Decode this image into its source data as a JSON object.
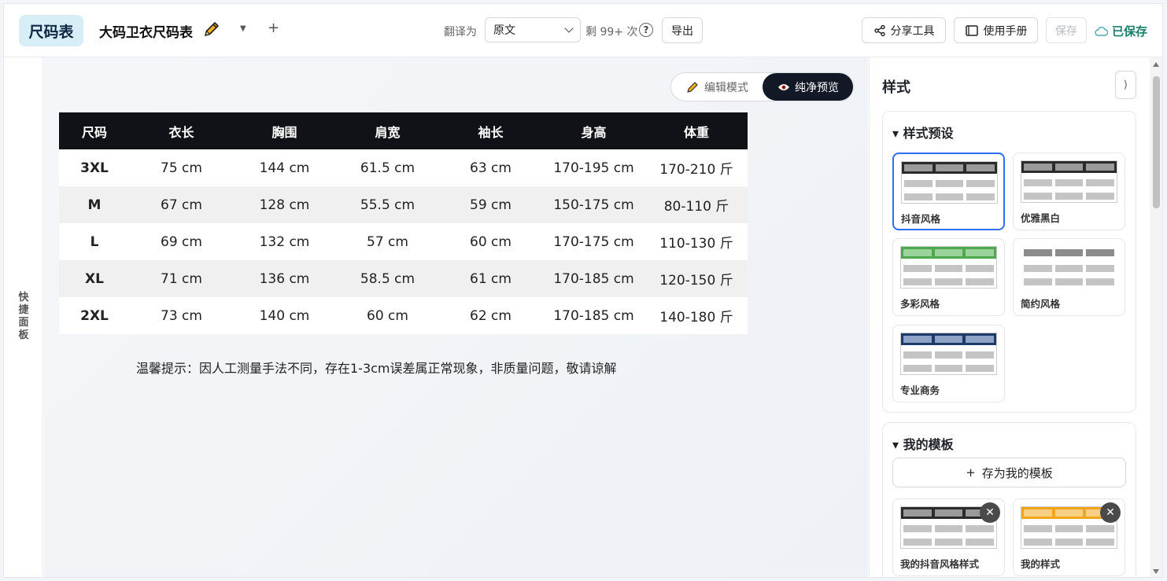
{
  "header": {
    "logo": "尺码表",
    "doc_title": "大码卫衣尺码表",
    "translate_label": "翻译为",
    "translate_value": "原文",
    "remaining": "剩 99+ 次",
    "help": "?",
    "export": "导出",
    "share": "分享工具",
    "manual": "使用手册",
    "save": "保存",
    "saved_status": "已保存"
  },
  "quick_panel": {
    "label": "快捷面板"
  },
  "mode": {
    "edit": "编辑模式",
    "preview": "纯净预览",
    "active": "preview"
  },
  "table": {
    "headers": [
      "尺码",
      "衣长",
      "胸围",
      "肩宽",
      "袖长",
      "身高",
      "体重"
    ],
    "rows": [
      [
        "3XL",
        "75 cm",
        "144 cm",
        "61.5 cm",
        "63 cm",
        "170-195 cm",
        "170-210 斤"
      ],
      [
        "M",
        "67 cm",
        "128 cm",
        "55.5 cm",
        "59 cm",
        "150-175 cm",
        "80-110 斤"
      ],
      [
        "L",
        "69 cm",
        "132 cm",
        "57 cm",
        "60 cm",
        "170-175 cm",
        "110-130 斤"
      ],
      [
        "XL",
        "71 cm",
        "136 cm",
        "58.5 cm",
        "61 cm",
        "170-185 cm",
        "120-150 斤"
      ],
      [
        "2XL",
        "73 cm",
        "140 cm",
        "60 cm",
        "62 cm",
        "170-185 cm",
        "140-180 斤"
      ]
    ]
  },
  "tip": "温馨提示：因人工测量手法不同，存在1-3cm误差属正常现象，非质量问题，敬请谅解",
  "style_panel": {
    "title": "样式",
    "collapse": "⟩",
    "presets_title": "▾ 样式预设",
    "presets": [
      {
        "name": "抖音风格",
        "head_color": "#2b2b2b",
        "head_cell": "#9a9a9a",
        "selected": true
      },
      {
        "name": "优雅黑白",
        "head_color": "#2b2b2b",
        "head_cell": "#9a9a9a",
        "selected": false
      },
      {
        "name": "多彩风格",
        "head_color": "#4ea84e",
        "head_cell": "#9ad49a",
        "selected": false
      },
      {
        "name": "简约风格",
        "head_color": "#ffffff",
        "head_cell": "#8c8c8c",
        "selected": false
      },
      {
        "name": "专业商务",
        "head_color": "#1e3a68",
        "head_cell": "#8da2c4",
        "selected": false
      }
    ],
    "my_templates_title": "▾ 我的模板",
    "save_as_template": "存为我的模板",
    "save_plus": "+",
    "my_templates": [
      {
        "name": "我的抖音风格样式",
        "head_color": "#2b2b2b",
        "head_cell": "#9a9a9a"
      },
      {
        "name": "我的样式",
        "head_color": "#f0a51c",
        "head_cell": "#f8d084"
      }
    ],
    "delete_symbol": "✕"
  },
  "colors": {
    "accent": "#2f6ef0",
    "saved_green": "#19806b",
    "table_header_bg": "#111217"
  }
}
